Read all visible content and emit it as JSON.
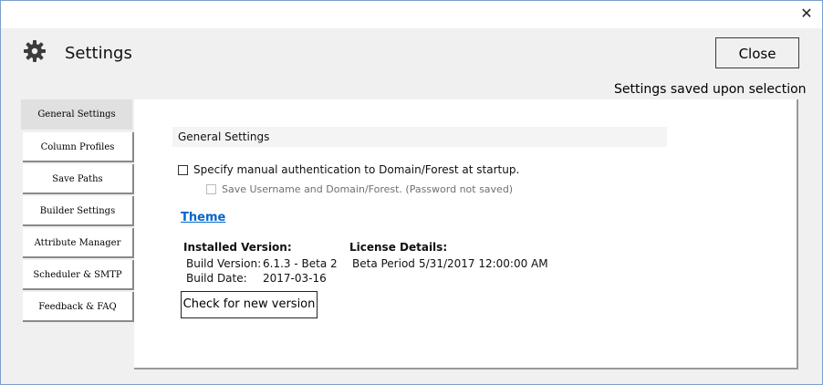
{
  "window": {
    "close_glyph": "✕"
  },
  "header": {
    "title": "Settings",
    "icon": "gear-icon",
    "close_label": "Close"
  },
  "status": {
    "saved_note": "Settings saved upon selection"
  },
  "sidebar": {
    "items": [
      {
        "label": "General Settings",
        "active": true
      },
      {
        "label": "Column Profiles",
        "active": false
      },
      {
        "label": "Save Paths",
        "active": false
      },
      {
        "label": "Builder Settings",
        "active": false
      },
      {
        "label": "Attribute Manager",
        "active": false
      },
      {
        "label": "Scheduler & SMTP",
        "active": false
      },
      {
        "label": "Feedback & FAQ",
        "active": false
      }
    ]
  },
  "general": {
    "section_title": "General Settings",
    "manual_auth_label": "Specify manual authentication to Domain/Forest at startup.",
    "save_username_label": "Save Username and Domain/Forest. (Password not saved)",
    "theme_link": "Theme",
    "installed_heading": "Installed Version:",
    "build_version_label": "Build Version:",
    "build_version_value": "6.1.3 - Beta 2",
    "build_date_label": "Build Date:",
    "build_date_value": "2017-03-16",
    "license_heading": "License Details:",
    "license_type": "Beta Period",
    "license_expiry": "5/31/2017 12:00:00 AM",
    "check_button": "Check for new version"
  },
  "colors": {
    "link": "#0066cc",
    "accent_border": "#7a9fd0"
  }
}
